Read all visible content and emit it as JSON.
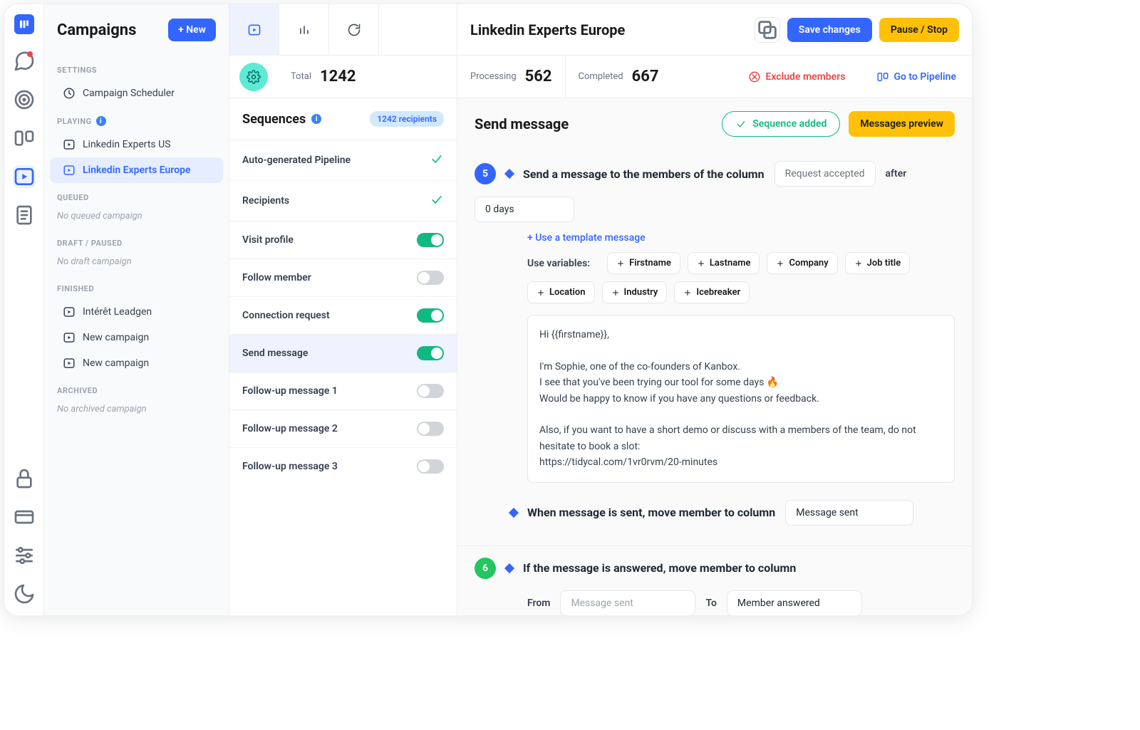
{
  "rail": {
    "items": [
      "messages",
      "target",
      "board",
      "campaigns",
      "notes"
    ],
    "bottom": [
      "lock",
      "card",
      "sliders",
      "moon"
    ]
  },
  "sidebar": {
    "title": "Campaigns",
    "new_label": "+ New",
    "sections": {
      "settings_label": "SETTINGS",
      "scheduler_label": "Campaign Scheduler",
      "playing_label": "PLAYING",
      "playing_items": [
        "Linkedin Experts US",
        "Linkedin Experts Europe"
      ],
      "queued_label": "QUEUED",
      "queued_empty": "No queued campaign",
      "draft_label": "DRAFT / PAUSED",
      "draft_empty": "No draft campaign",
      "finished_label": "FINISHED",
      "finished_items": [
        "Intérêt Leadgen",
        "New campaign",
        "New campaign"
      ],
      "archived_label": "ARCHIVED",
      "archived_empty": "No archived campaign"
    }
  },
  "header": {
    "campaign_title": "Linkedin Experts Europe",
    "save_label": "Save changes",
    "pause_label": "Pause / Stop"
  },
  "stats": {
    "total_label": "Total",
    "total_value": "1242",
    "processing_label": "Processing",
    "processing_value": "562",
    "completed_label": "Completed",
    "completed_value": "667",
    "exclude_label": "Exclude members",
    "pipeline_label": "Go to Pipeline"
  },
  "sequences": {
    "title": "Sequences",
    "recipients_badge": "1242 recipients",
    "rows": [
      {
        "label": "Auto-generated Pipeline",
        "kind": "check"
      },
      {
        "label": "Recipients",
        "kind": "check"
      },
      {
        "label": "Visit profile",
        "kind": "toggle",
        "on": true
      },
      {
        "label": "Follow member",
        "kind": "toggle",
        "on": false
      },
      {
        "label": "Connection request",
        "kind": "toggle",
        "on": true
      },
      {
        "label": "Send message",
        "kind": "toggle",
        "on": true,
        "selected": true
      },
      {
        "label": "Follow-up message 1",
        "kind": "toggle",
        "on": false
      },
      {
        "label": "Follow-up message 2",
        "kind": "toggle",
        "on": false
      },
      {
        "label": "Follow-up message 3",
        "kind": "toggle",
        "on": false
      }
    ]
  },
  "detail": {
    "title": "Send message",
    "added_label": "Sequence added",
    "preview_label": "Messages preview",
    "step5": {
      "num": "5",
      "title": "Send a message to the members of the column",
      "column": "Request accepted",
      "after_label": "after",
      "delay": "0 days",
      "template_link": "+ Use a template message",
      "vars_label": "Use variables:",
      "vars": [
        "Firstname",
        "Lastname",
        "Company",
        "Job title",
        "Location",
        "Industry",
        "Icebreaker"
      ],
      "message": "Hi {{firstname}},\n\nI'm Sophie, one of the co-founders of Kanbox.\nI see that you've been trying our tool for some days 🔥\nWould be happy to know if you have any questions or feedback.\n\nAlso, if you want to have a short demo or discuss with a members of the team, do not hesitate to book a slot:\nhttps://tidycal.com/1vr0rvm/20-minutes",
      "move_title": "When message is sent, move member to column",
      "move_column": "Message sent"
    },
    "step6": {
      "num": "6",
      "title": "If the message is answered, move member to column",
      "from_label": "From",
      "from_value": "Message sent",
      "to_label": "To",
      "to_value": "Member answered"
    }
  }
}
